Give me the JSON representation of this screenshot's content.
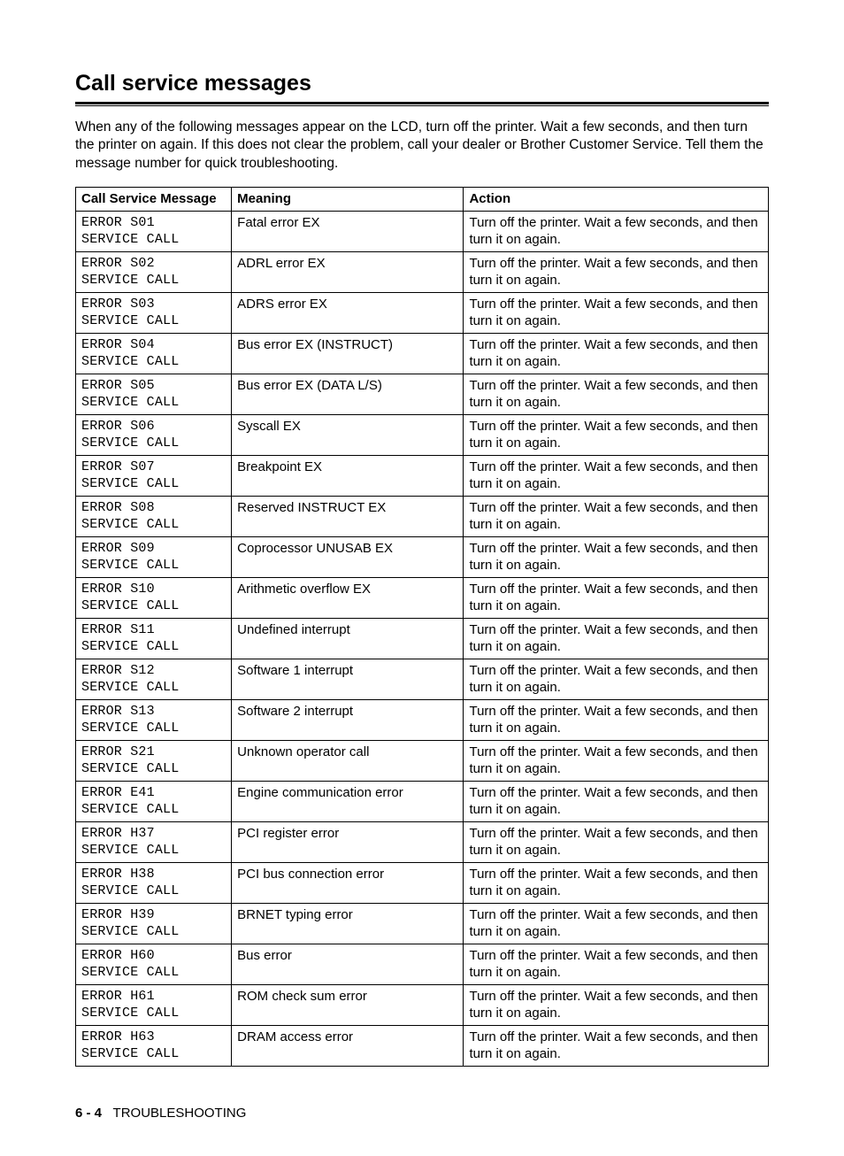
{
  "heading": "Call service messages",
  "intro": "When any of the following messages appear on the LCD, turn off the printer. Wait a few seconds, and then turn the printer on again. If this does not clear the problem, call your dealer or Brother Customer Service. Tell them the message number for quick troubleshooting.",
  "table": {
    "headers": {
      "col1": "Call Service Message",
      "col2": "Meaning",
      "col3": "Action"
    },
    "rows": [
      {
        "msg": "ERROR S01\nSERVICE CALL",
        "meaning": "Fatal error EX",
        "action": "Turn off the printer. Wait a few seconds, and then turn it on again."
      },
      {
        "msg": "ERROR S02\nSERVICE CALL",
        "meaning": "ADRL error EX",
        "action": "Turn off the printer. Wait a few seconds, and then turn it on again."
      },
      {
        "msg": "ERROR S03\nSERVICE CALL",
        "meaning": "ADRS error EX",
        "action": "Turn off the printer. Wait a few seconds, and then turn it on again."
      },
      {
        "msg": "ERROR S04\nSERVICE CALL",
        "meaning": "Bus error EX (INSTRUCT)",
        "action": "Turn off the printer. Wait a few seconds, and then turn it on again."
      },
      {
        "msg": "ERROR S05\nSERVICE CALL",
        "meaning": "Bus error EX (DATA L/S)",
        "action": "Turn off the printer. Wait a few seconds, and then turn it on again."
      },
      {
        "msg": "ERROR S06\nSERVICE CALL",
        "meaning": "Syscall EX",
        "action": "Turn off the printer. Wait a few seconds, and then turn it on again."
      },
      {
        "msg": "ERROR S07\nSERVICE CALL",
        "meaning": "Breakpoint EX",
        "action": "Turn off the printer. Wait a few seconds, and then turn it on again."
      },
      {
        "msg": "ERROR S08\nSERVICE CALL",
        "meaning": "Reserved INSTRUCT EX",
        "action": "Turn off the printer. Wait a few seconds, and then turn it on again."
      },
      {
        "msg": "ERROR S09\nSERVICE CALL",
        "meaning": "Coprocessor UNUSAB EX",
        "action": "Turn off the printer. Wait a few seconds, and then turn it on again."
      },
      {
        "msg": "ERROR S10\nSERVICE CALL",
        "meaning": "Arithmetic overflow EX",
        "action": "Turn off the printer. Wait a few seconds, and then turn it on again."
      },
      {
        "msg": "ERROR S11\nSERVICE CALL",
        "meaning": "Undefined interrupt",
        "action": "Turn off the printer. Wait a few seconds, and then turn it on again."
      },
      {
        "msg": "ERROR S12\nSERVICE CALL",
        "meaning": "Software 1 interrupt",
        "action": "Turn off the printer. Wait a few seconds, and then turn it on again."
      },
      {
        "msg": "ERROR S13\nSERVICE CALL",
        "meaning": "Software 2 interrupt",
        "action": "Turn off the printer. Wait a few seconds, and then turn it on again."
      },
      {
        "msg": "ERROR S21\nSERVICE CALL",
        "meaning": "Unknown operator call",
        "action": "Turn off the printer. Wait a few seconds, and then turn it on again."
      },
      {
        "msg": "ERROR E41\nSERVICE CALL",
        "meaning": "Engine communication error",
        "action": "Turn off the printer. Wait a few seconds, and then turn it on again."
      },
      {
        "msg": "ERROR H37\nSERVICE CALL",
        "meaning": "PCI register error",
        "action": "Turn off the printer. Wait a few seconds, and then turn it on again."
      },
      {
        "msg": "ERROR H38\nSERVICE CALL",
        "meaning": "PCI bus connection error",
        "action": "Turn off the printer. Wait a few seconds, and then turn it on again."
      },
      {
        "msg": "ERROR H39\nSERVICE CALL",
        "meaning": "BRNET typing error",
        "action": "Turn off the printer. Wait a few seconds, and then turn it on again."
      },
      {
        "msg": "ERROR H60\nSERVICE CALL",
        "meaning": "Bus error",
        "action": "Turn off the printer. Wait a few seconds, and then turn it on again."
      },
      {
        "msg": "ERROR H61\nSERVICE CALL",
        "meaning": "ROM check sum error",
        "action": "Turn off the printer. Wait a few seconds, and then turn it on again."
      },
      {
        "msg": "ERROR H63\nSERVICE CALL",
        "meaning": "DRAM access error",
        "action": "Turn off the printer. Wait a few seconds, and then turn it on again."
      }
    ]
  },
  "footer": {
    "page": "6 - 4",
    "section": "TROUBLESHOOTING"
  }
}
